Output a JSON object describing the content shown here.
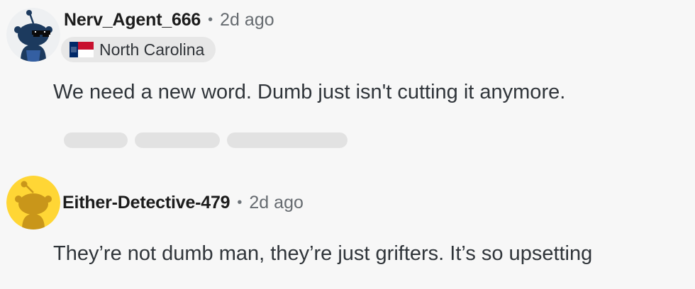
{
  "comments": [
    {
      "username": "Nerv_Agent_666",
      "separator": "•",
      "time": "2d ago",
      "flair": {
        "text": "North Carolina",
        "icon": "north-carolina-flag-icon"
      },
      "body": "We need a new word. Dumb just isn't cutting it anymore.",
      "avatar": "snoo-sunglasses-avatar"
    },
    {
      "username": "Either-Detective-479",
      "separator": "•",
      "time": "2d ago",
      "body": "They’re not dumb man, they’re just grifters. It’s so upsetting",
      "avatar": "snoo-default-avatar"
    }
  ],
  "colors": {
    "background": "#f7f7f7",
    "avatar1_bg": "#ffffff",
    "avatar1_snoo": "#1c3a5e",
    "avatar2_bg": "#ffd635",
    "avatar2_snoo": "#d4a31c",
    "flair_bg": "#e7e7e7",
    "nc_flag_red": "#c8102e",
    "nc_flag_blue": "#002868"
  }
}
